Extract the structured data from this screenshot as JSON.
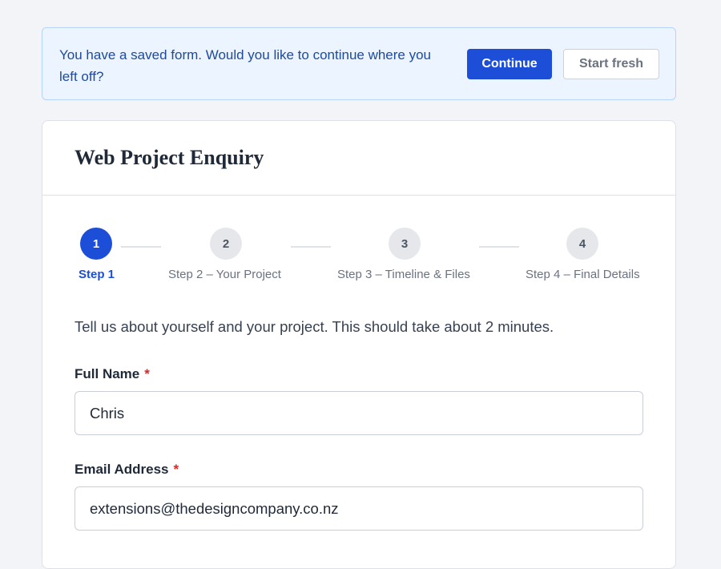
{
  "banner": {
    "message": "You have a saved form. Would you like to continue where you left off?",
    "continue_label": "Continue",
    "start_fresh_label": "Start fresh"
  },
  "form": {
    "title": "Web Project Enquiry",
    "intro": "Tell us about yourself and your project. This should take about 2 minutes.",
    "steps": [
      {
        "number": "1",
        "label": "Step 1",
        "state": "active"
      },
      {
        "number": "2",
        "label": "Step 2 – Your Project",
        "state": "inactive"
      },
      {
        "number": "3",
        "label": "Step 3 – Timeline & Files",
        "state": "inactive"
      },
      {
        "number": "4",
        "label": "Step 4 – Final Details",
        "state": "inactive"
      }
    ],
    "fields": {
      "full_name": {
        "label": "Full Name",
        "required_mark": "*",
        "value": "Chris"
      },
      "email": {
        "label": "Email Address",
        "required_mark": "*",
        "value": "extensions@thedesigncompany.co.nz"
      }
    }
  },
  "colors": {
    "accent": "#1d4ed8",
    "banner_bg": "#ebf4ff",
    "required": "#dc2626"
  }
}
